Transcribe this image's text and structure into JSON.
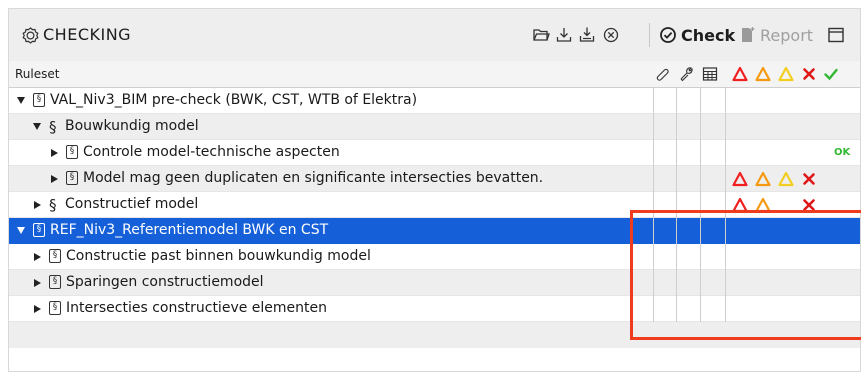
{
  "panel": {
    "title": "CHECKING",
    "title_icon": "checking-badge-icon",
    "toolbar": {
      "open_icon": "folder-open-icon",
      "download_icon": "download-icon",
      "download_all_icon": "download-tray-icon",
      "close_icon": "close-circle-icon",
      "check_label": "Check",
      "check_icon": "check-circle-icon",
      "report_label": "Report",
      "report_icon": "report-icon",
      "window_icon": "window-icon"
    }
  },
  "header": {
    "ruleset_label": "Ruleset",
    "column_icons": [
      "attachment-icon",
      "wrench-icon",
      "table-icon",
      "critical-triangle-icon",
      "major-triangle-icon",
      "minor-triangle-icon",
      "fail-x-icon",
      "pass-check-icon"
    ]
  },
  "rows": [
    {
      "label": "VAL_Niv3_BIM pre-check (BWK, CST, WTB of Elektra)",
      "expanded": true,
      "kind": "ruleset"
    },
    {
      "label": "Bouwkundig model",
      "expanded": true,
      "kind": "section"
    },
    {
      "label": "Controle model-technische aspecten",
      "expanded": false,
      "kind": "ruleset",
      "status": "OK"
    },
    {
      "label": "Model mag geen duplicaten en significante intersecties bevatten.",
      "expanded": false,
      "kind": "ruleset"
    },
    {
      "label": "Constructief model",
      "expanded": false,
      "kind": "section"
    },
    {
      "label": "REF_Niv3_Referentiemodel BWK en CST",
      "expanded": true,
      "kind": "ruleset",
      "selected": true
    },
    {
      "label": "Constructie past binnen bouwkundig model",
      "expanded": false,
      "kind": "ruleset"
    },
    {
      "label": "Sparingen constructiemodel",
      "expanded": false,
      "kind": "ruleset"
    },
    {
      "label": "Intersecties constructieve elementen",
      "expanded": false,
      "kind": "ruleset"
    }
  ],
  "colors": {
    "critical": "#f02020",
    "major": "#f59a10",
    "minor": "#f2cf1f",
    "fail": "#e01818",
    "pass": "#32b832",
    "selection": "#1560d8",
    "annotation_box": "#f03c1e"
  }
}
